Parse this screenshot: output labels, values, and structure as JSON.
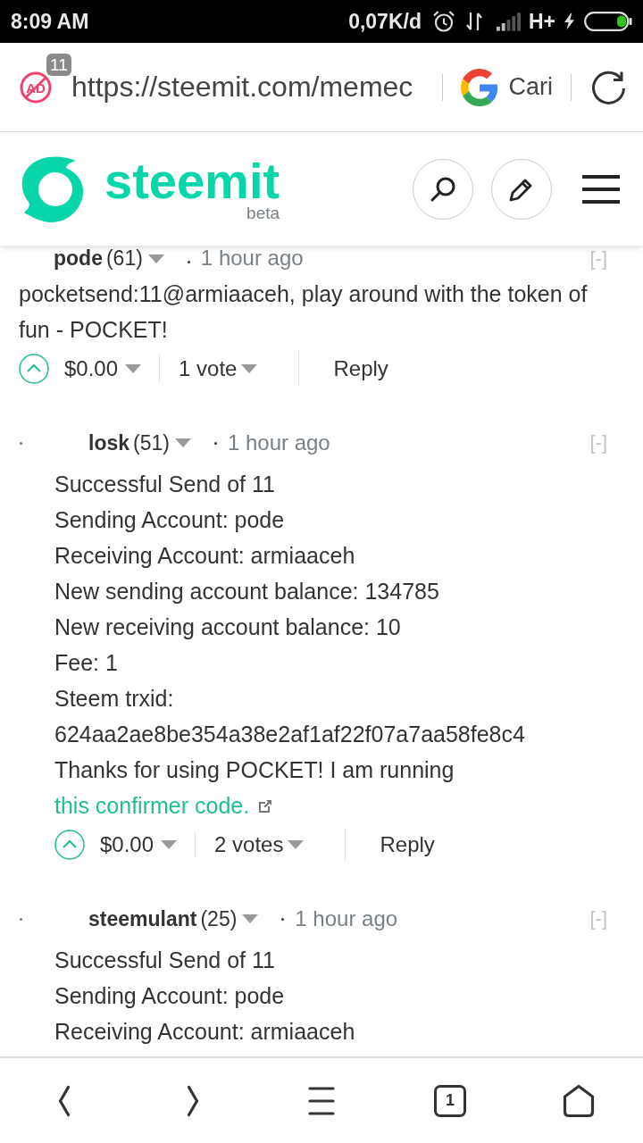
{
  "status_bar": {
    "time": "8:09 AM",
    "network_speed": "0,07K/d",
    "network_type": "H+"
  },
  "browser_bar": {
    "ad_icon_label": "AD",
    "ad_count": "11",
    "url": "https://steemit.com/memec",
    "search_label": "Cari"
  },
  "site_header": {
    "logo_text": "steemit",
    "logo_tag": "beta"
  },
  "comments": [
    {
      "author": "pode",
      "reputation": "(61)",
      "time": "1 hour ago",
      "collapse": "[-]",
      "body": [
        {
          "text": "pocketsend:11@armiaaceh, play around with the token of fun - POCKET!"
        }
      ],
      "payout": "$0.00",
      "votes": "1 vote",
      "reply": "Reply",
      "children": [
        {
          "author": "losk",
          "reputation": "(51)",
          "time": "1 hour ago",
          "collapse": "[-]",
          "body": [
            {
              "text": "Successful Send of 11"
            },
            {
              "text": "Sending Account: pode"
            },
            {
              "text": "Receiving Account: armiaaceh"
            },
            {
              "text": "New sending account balance: 134785"
            },
            {
              "text": "New receiving account balance: 10"
            },
            {
              "text": "Fee: 1"
            },
            {
              "text": "Steem trxid:"
            },
            {
              "text": "624aa2ae8be354a38e2af1af22f07a7aa58fe8c4"
            },
            {
              "text": "Thanks for using POCKET! I am running",
              "link": "this confirmer code."
            }
          ],
          "payout": "$0.00",
          "votes": "2 votes",
          "reply": "Reply"
        },
        {
          "author": "steemulant",
          "reputation": "(25)",
          "time": "1 hour ago",
          "collapse": "[-]",
          "body": [
            {
              "text": "Successful Send of 11"
            },
            {
              "text": "Sending Account: pode"
            },
            {
              "text": "Receiving Account: armiaaceh"
            }
          ]
        }
      ]
    }
  ],
  "bottom_nav": {
    "tab_count": "1"
  }
}
